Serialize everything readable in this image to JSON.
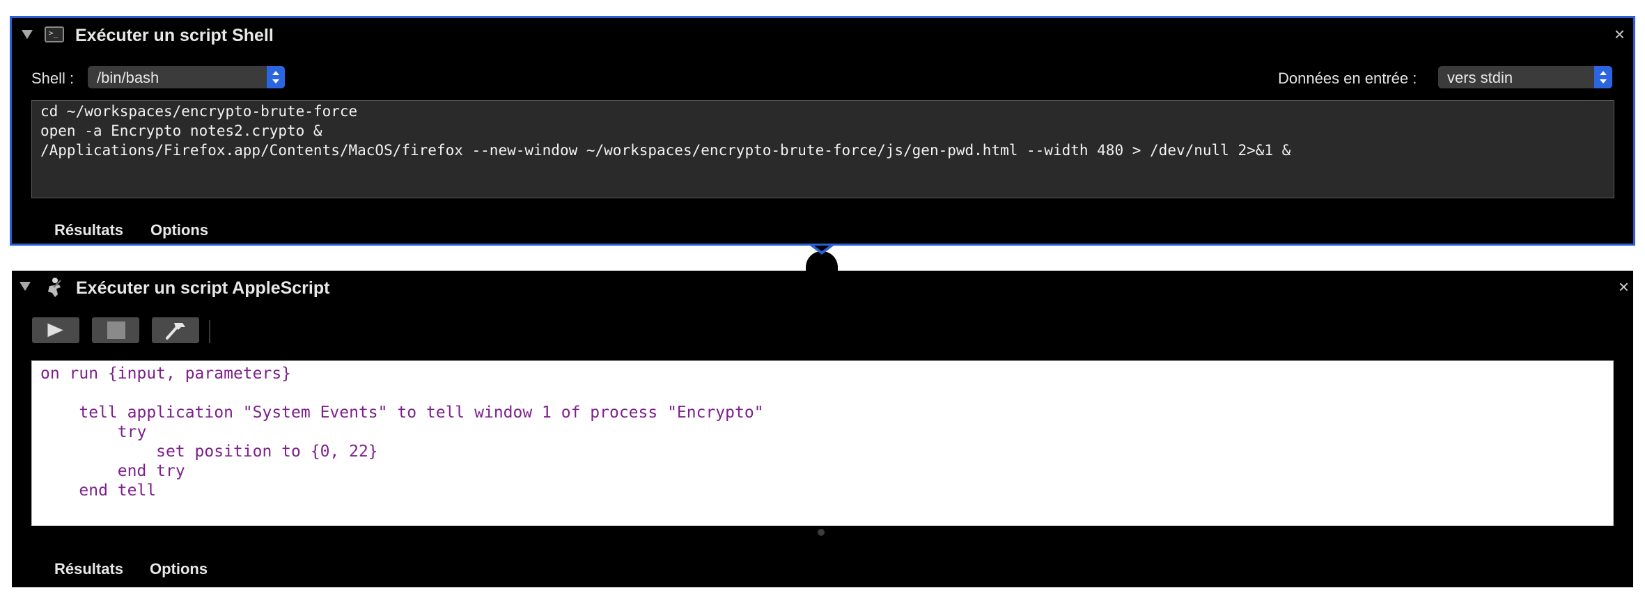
{
  "shell_action": {
    "title": "Exécuter un script Shell",
    "icon": "terminal-icon",
    "terminal_glyph": ">_",
    "close_glyph": "×",
    "shell_label": "Shell :",
    "shell_value": "/bin/bash",
    "input_label": "Données en entrée :",
    "input_value": "vers stdin",
    "code_lines": [
      "cd ~/workspaces/encrypto-brute-force",
      "open -a Encrypto notes2.crypto &",
      "/Applications/Firefox.app/Contents/MacOS/firefox --new-window ~/workspaces/encrypto-brute-force/js/gen-pwd.html --width 480 > /dev/null 2>&1 &"
    ],
    "results_tab": "Résultats",
    "options_tab": "Options",
    "accent_color": "#2a5fd6"
  },
  "applescript_action": {
    "title": "Exécuter un script AppleScript",
    "icon": "applescript-icon",
    "close_glyph": "×",
    "toolbar": {
      "run": "play-icon",
      "stop": "stop-icon",
      "compile": "hammer-icon"
    },
    "code_lines": [
      "on run {input, parameters}",
      "",
      "    tell application \"System Events\" to tell window 1 of process \"Encrypto\"",
      "        try",
      "            set position to {0, 22}",
      "        end try",
      "    end tell"
    ],
    "results_tab": "Résultats",
    "options_tab": "Options",
    "code_color": "#7d1f8c"
  }
}
